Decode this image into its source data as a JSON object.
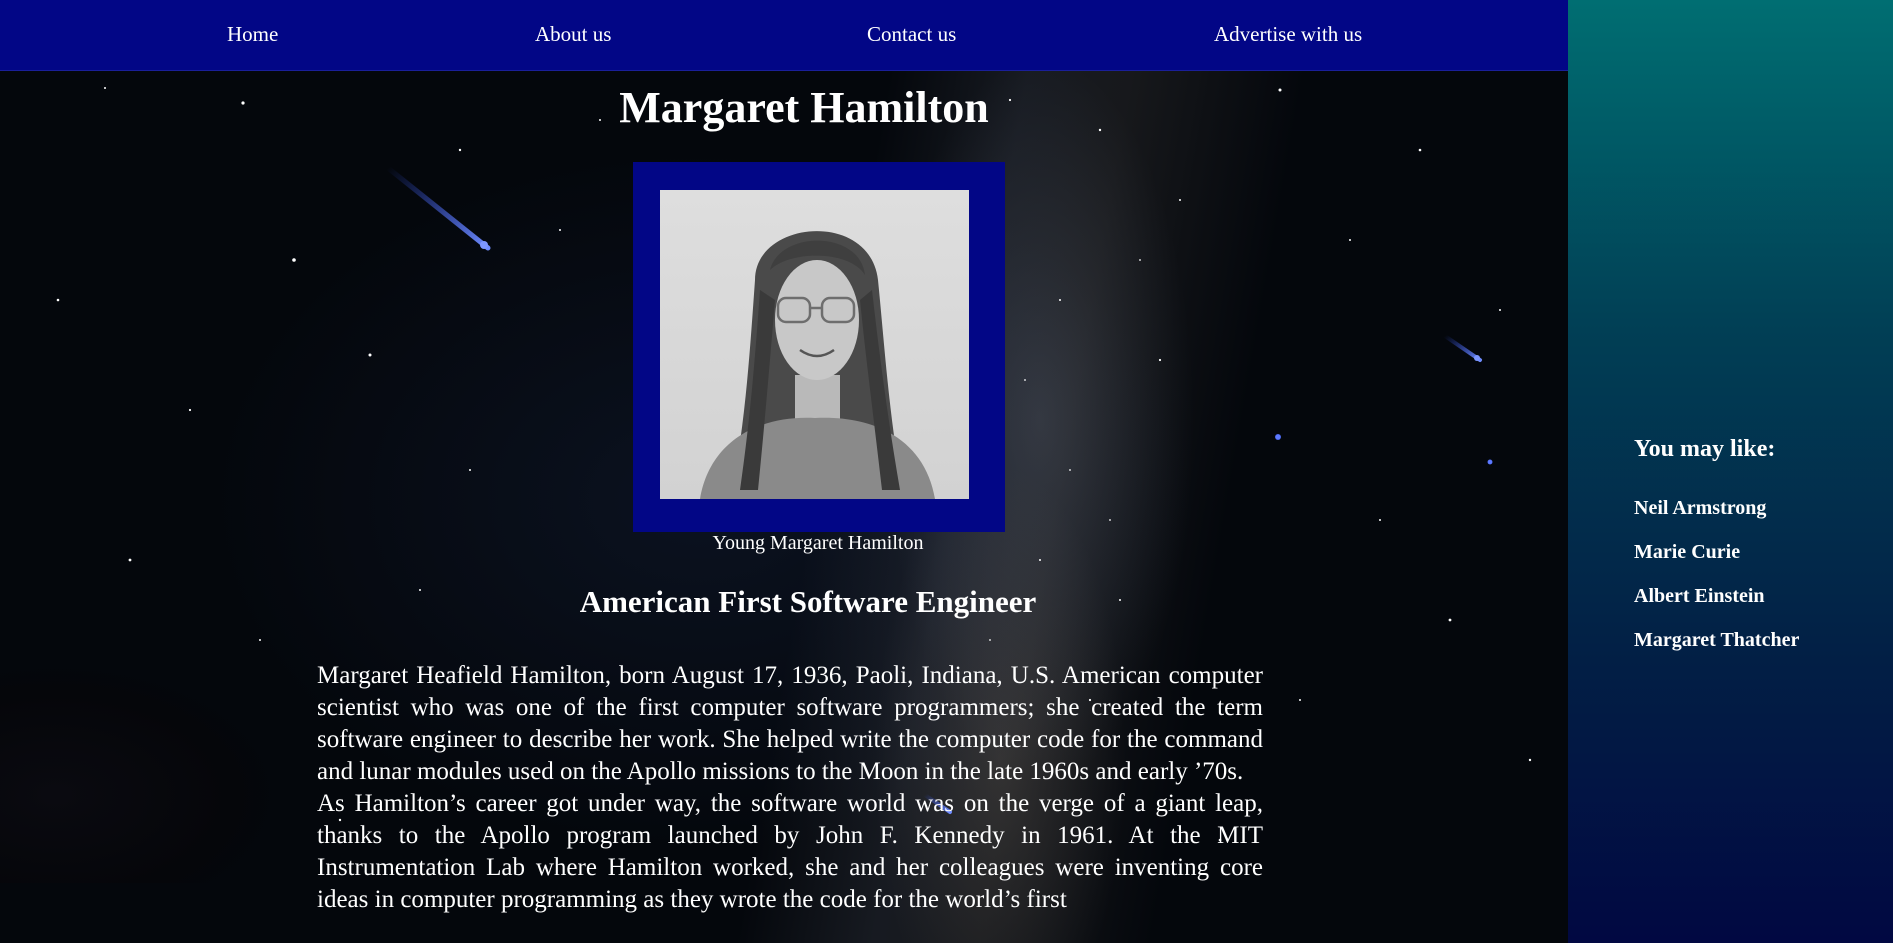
{
  "nav": {
    "items": [
      {
        "label": "Home"
      },
      {
        "label": "About us"
      },
      {
        "label": "Contact us"
      },
      {
        "label": "Advertise with us"
      }
    ]
  },
  "article": {
    "title": "Margaret Hamilton",
    "image_caption": "Young Margaret Hamilton",
    "subtitle": "American First Software Engineer",
    "paragraphs": [
      "Margaret Heafield Hamilton, born August 17, 1936, Paoli, Indiana, U.S. American computer scientist who was one of the first computer software programmers; she created the term software engineer to describe her work. She helped write the computer code for the command and lunar modules used on the Apollo missions to the Moon in the late 1960s and early ’70s.",
      "As Hamilton’s career got under way, the software world was on the verge of a giant leap, thanks to the Apollo program launched by John F. Kennedy in 1961. At the MIT Instrumentation Lab where Hamilton worked, she and her colleagues were inventing core ideas in computer programming as they wrote the code for the world’s first"
    ]
  },
  "sidebar": {
    "heading": "You may like:",
    "items": [
      {
        "label": "Neil Armstrong"
      },
      {
        "label": "Marie Curie"
      },
      {
        "label": "Albert Einstein"
      },
      {
        "label": "Margaret Thatcher"
      }
    ]
  },
  "colors": {
    "nav_background": "#020686",
    "photo_frame": "#020686",
    "sidebar_top": "#006e72",
    "sidebar_bottom": "#010842",
    "text": "#ffffff"
  }
}
